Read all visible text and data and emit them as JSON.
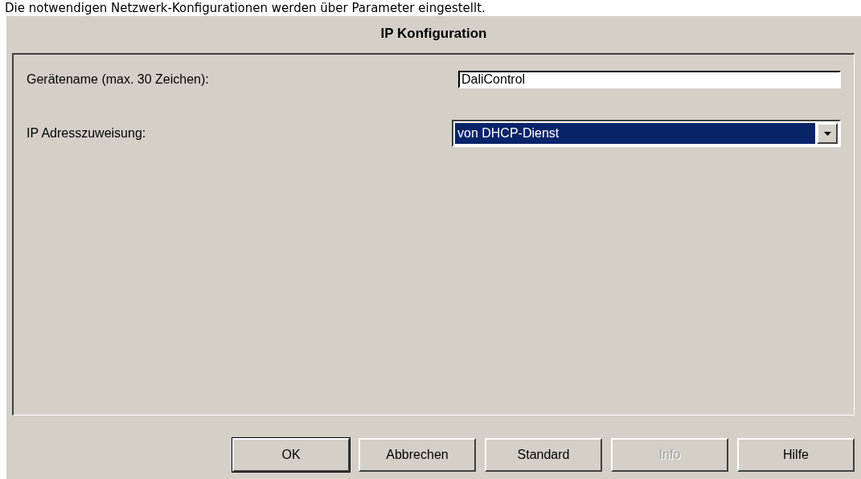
{
  "document_text": "Die notwendigen Netzwerk-Konfigurationen werden über Parameter eingestellt.",
  "window": {
    "title": "IP Konfiguration"
  },
  "fields": [
    {
      "kind": "text",
      "label": "Gerätename (max. 30 Zeichen):",
      "value": "DaliControl"
    },
    {
      "kind": "dropdown",
      "label": "IP Adresszuweisung:",
      "value": "von DHCP-Dienst",
      "focused": true
    }
  ],
  "buttons": [
    {
      "label": "OK",
      "default": true,
      "disabled": false
    },
    {
      "label": "Abbrechen",
      "default": false,
      "disabled": false
    },
    {
      "label": "Standard",
      "default": false,
      "disabled": false
    },
    {
      "label": "Info",
      "default": false,
      "disabled": true
    },
    {
      "label": "Hilfe",
      "default": false,
      "disabled": false
    }
  ]
}
